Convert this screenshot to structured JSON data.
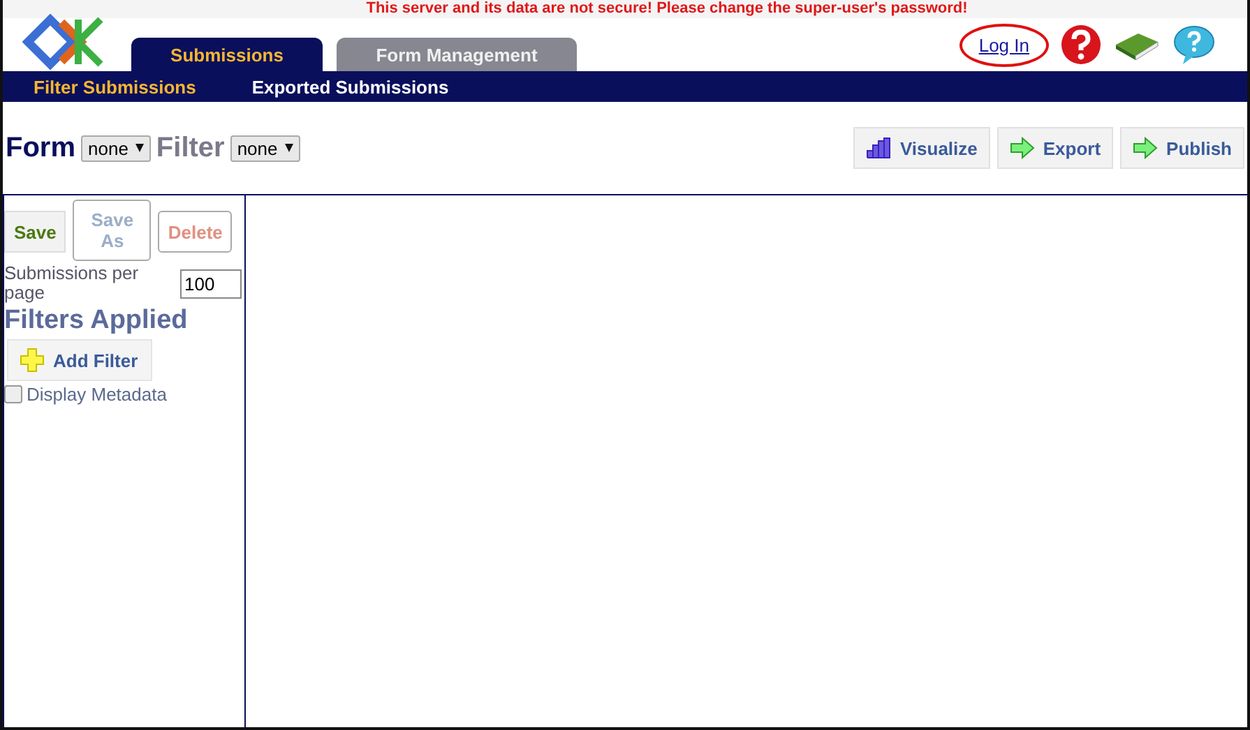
{
  "warning": "This server and its data are not secure! Please change the super-user's password!",
  "tabs": [
    {
      "label": "Submissions",
      "selected": true
    },
    {
      "label": "Form Management",
      "selected": false
    }
  ],
  "login": "Log In",
  "subnav": [
    {
      "label": "Filter Submissions",
      "selected": true
    },
    {
      "label": "Exported Submissions",
      "selected": false
    }
  ],
  "form_label": "Form",
  "form_select": "none",
  "filter_label": "Filter",
  "filter_select": "none",
  "actions": [
    {
      "label": "Visualize",
      "kind": "chart"
    },
    {
      "label": "Export",
      "kind": "arrow"
    },
    {
      "label": "Publish",
      "kind": "arrow"
    }
  ],
  "sidebar": {
    "buttons": [
      {
        "label": "Save",
        "kind": "save",
        "disabled": false
      },
      {
        "label": "Save As",
        "kind": "saveas",
        "disabled": true
      },
      {
        "label": "Delete",
        "kind": "delete",
        "disabled": true
      }
    ],
    "per_page_label": "Submissions per page",
    "per_page": "100",
    "heading": "Filters Applied",
    "add_filter": "Add Filter",
    "metadata": {
      "label": "Display Metadata",
      "checked": false
    }
  }
}
